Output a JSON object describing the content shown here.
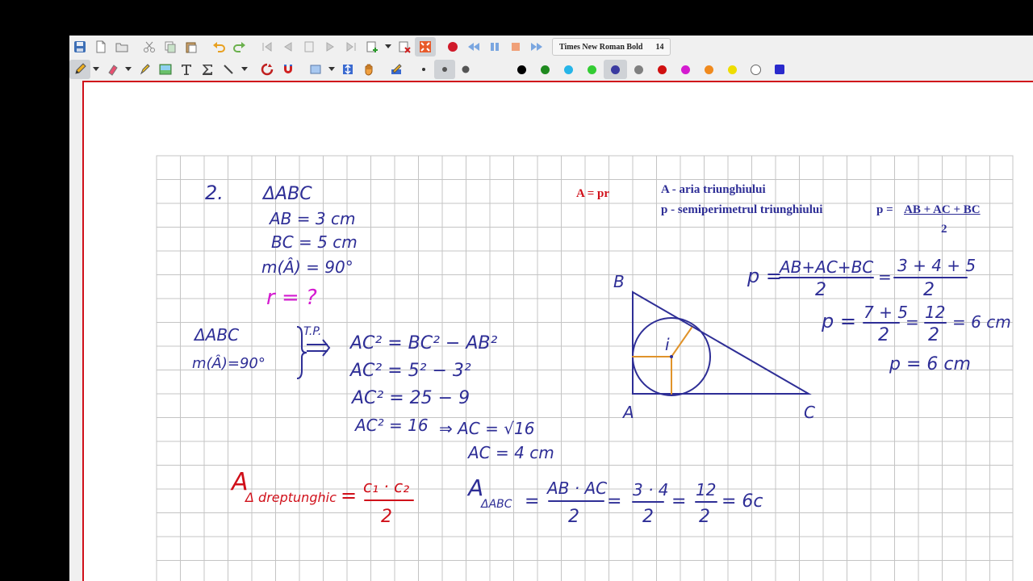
{
  "toolbar_font": {
    "name": "Times New Roman Bold",
    "size": "14"
  },
  "colors": {
    "frame_accent": "#d0101a",
    "ink_blue": "#2e2e96",
    "ink_red": "#d0101a",
    "ink_magenta": "#d41bd0",
    "ink_orange": "#e0932a",
    "grid": "#c4c4c4",
    "palette": [
      "#000000",
      "#1f8a1f",
      "#26b5e8",
      "#33cc33",
      "#3a3aa0",
      "#808080",
      "#d01010",
      "#d41bd0",
      "#f08a1e",
      "#eedd00",
      "#ffffff",
      "#2a2acc"
    ]
  },
  "text": {
    "formula": "A = pr",
    "legend_a": "A - aria triunghiului",
    "legend_p": "p - semiperimetrul triunghiului",
    "p_def": "p =",
    "p_numerator": "AB + AC + BC",
    "p_denominator": "2"
  },
  "handwriting": {
    "problem_number": "2.",
    "given_triangle": "ΔABC",
    "given_ab": "AB = 3 cm",
    "given_bc": "BC = 5 cm",
    "given_angle": "m(Â) = 90°",
    "question": "r = ?",
    "hyp_triangle": "ΔABC",
    "hyp_angle": "m(Â)=90°",
    "theorem": "T.P.",
    "step1": "AC² = BC² − AB²",
    "step2": "AC² = 5² − 3²",
    "step3": "AC² = 25 − 9",
    "step4": "AC² = 16",
    "step4b": "⇒ AC = √16",
    "step5": "AC = 4 cm",
    "area_formula_lhs": "A",
    "area_formula_sub": "Δ dreptunghic",
    "area_formula_num": "c₁ · c₂",
    "area_formula_den": "2",
    "area_abc_lhs": "A",
    "area_abc_sub": "ΔABC",
    "area_abc_num": "AB · AC",
    "area_abc_den": "2",
    "area_abc_num2": "3 · 4",
    "area_abc_den2": "2",
    "area_abc_num3": "12",
    "area_abc_den3": "2",
    "area_abc_result": "= 6c",
    "p_line1_lhs": "p =",
    "p_line1_num": "AB+AC+BC",
    "p_line1_den": "2",
    "p_line1_num2": "3 + 4 + 5",
    "p_line1_den2": "2",
    "p_line2_lhs": "p =",
    "p_line2_num": "7 + 5",
    "p_line2_den": "2",
    "p_line2_num2": "12",
    "p_line2_den2": "2",
    "p_line2_result": "= 6 cm",
    "p_final": "p = 6 cm",
    "vertex_a": "A",
    "vertex_b": "B",
    "vertex_c": "C",
    "incenter": "i"
  }
}
